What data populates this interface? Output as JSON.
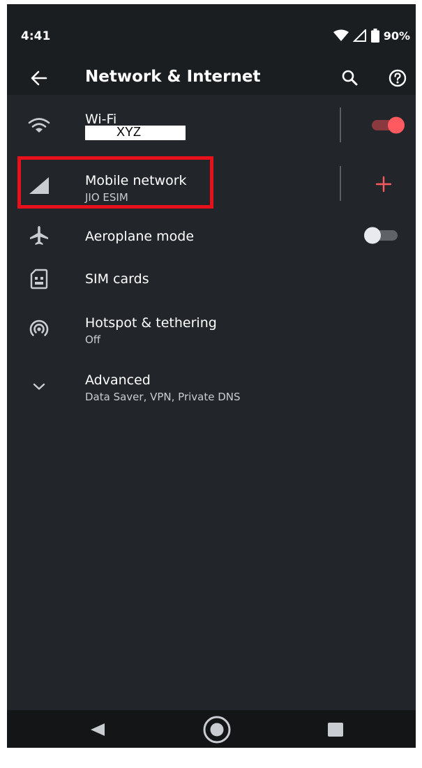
{
  "status_bar": {
    "time": "4:41",
    "battery": "90%"
  },
  "app_bar": {
    "title": "Network & Internet"
  },
  "settings": {
    "wifi": {
      "title": "Wi-Fi",
      "subtitle": "XYZ",
      "icon": "wifi-icon",
      "toggle_on": true
    },
    "mobile_network": {
      "title": "Mobile network",
      "subtitle": "JIO ESIM",
      "icon": "signal-icon",
      "action_icon": "plus-icon"
    },
    "aeroplane_mode": {
      "title": "Aeroplane mode",
      "icon": "airplane-icon",
      "toggle_on": false
    },
    "sim_cards": {
      "title": "SIM cards",
      "icon": "sim-card-icon"
    },
    "hotspot": {
      "title": "Hotspot & tethering",
      "subtitle": "Off",
      "icon": "hotspot-icon"
    },
    "advanced": {
      "title": "Advanced",
      "subtitle": "Data Saver, VPN, Private DNS",
      "icon": "chevron-down-icon"
    }
  },
  "colors": {
    "background": "#22262a",
    "accent": "#ff5a5f",
    "highlight_border": "#e8101a"
  }
}
